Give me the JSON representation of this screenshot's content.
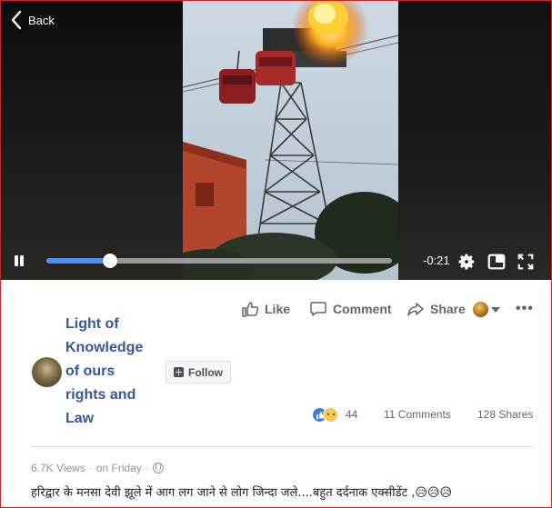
{
  "video": {
    "back_label": "Back",
    "time_remaining": "-0:21",
    "progress_fraction": 0.185
  },
  "actions": {
    "like_label": "Like",
    "comment_label": "Comment",
    "share_label": "Share",
    "more_label": "•••"
  },
  "page": {
    "name": "Light of Knowledge of ours rights and Law",
    "follow_label": "Follow"
  },
  "stats": {
    "reaction_count": "44",
    "comments": "11 Comments",
    "shares": "128 Shares"
  },
  "post": {
    "views": "6.7K Views",
    "separator": "·",
    "date": "on Friday",
    "separator2": "·",
    "caption": "हरिद्वार के मनसा देवी झूले में आग लग जाने से लोग जिन्दा जले....बहुत दर्दनाक एक्सीडेंट ,😥😥😥"
  },
  "colors": {
    "link_blue": "#365899",
    "progress_blue": "#4a90f5",
    "frame_red": "#c62828",
    "secondary_text": "#606770"
  },
  "icons": [
    "chevron-left-icon",
    "pause-icon",
    "gear-icon",
    "pip-icon",
    "fullscreen-icon",
    "like-icon",
    "comment-icon",
    "share-icon",
    "globe-icon"
  ]
}
